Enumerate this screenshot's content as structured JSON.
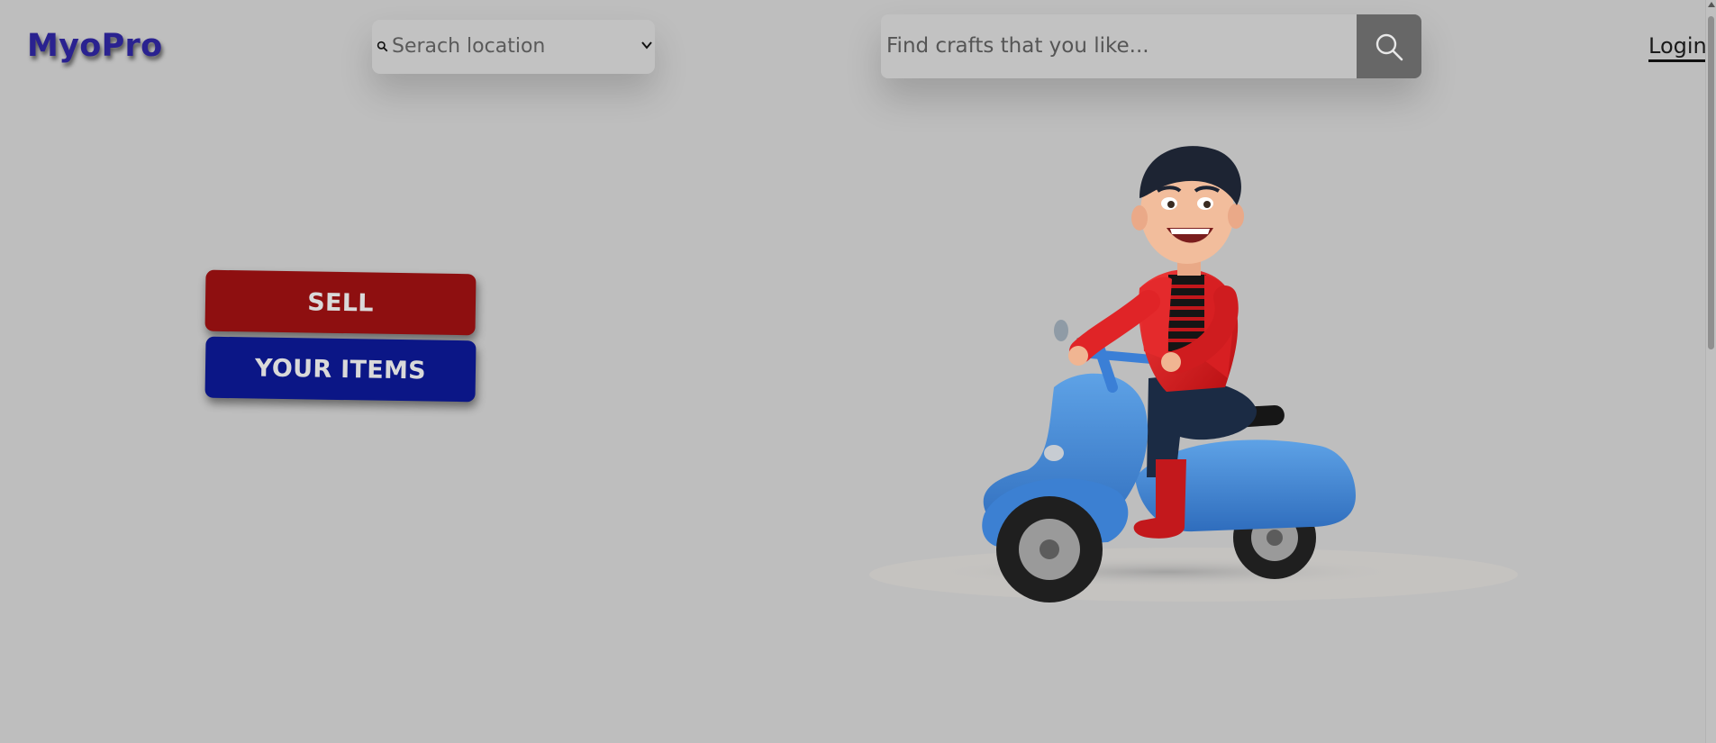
{
  "header": {
    "logo": "MyoPro",
    "location": {
      "placeholder": "Serach location",
      "icon_search": "search-icon",
      "icon_dropdown": "chevron-down-icon"
    },
    "craft_search": {
      "placeholder": "Find crafts that you like...",
      "button_icon": "search-icon"
    },
    "login_label": "Login"
  },
  "actions": {
    "sell_label": "SELL",
    "items_label": "YOUR ITEMS"
  },
  "colors": {
    "logo": "#2a2290",
    "sell_button": "#8e0f10",
    "items_button": "#0b1686",
    "search_button": "#676767",
    "background": "#bebebe"
  }
}
